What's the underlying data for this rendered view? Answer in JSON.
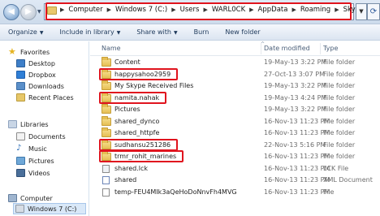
{
  "nav_buttons": {
    "back_glyph": "◀",
    "forward_glyph": "▶"
  },
  "address_bar": {
    "crumbs": [
      "Computer",
      "Windows 7 (C:)",
      "Users",
      "WARL0CK",
      "AppData",
      "Roaming",
      "Skype"
    ],
    "separator": "▶",
    "dropdown_glyph": "▼",
    "refresh_glyph": "⟳"
  },
  "toolbar": {
    "organize": "Organize",
    "include_in_library": "Include in library",
    "share_with": "Share with",
    "burn": "Burn",
    "new_folder": "New folder",
    "caret": "▼"
  },
  "nav_pane": {
    "favorites": "Favorites",
    "desktop": "Desktop",
    "dropbox": "Dropbox",
    "downloads": "Downloads",
    "recent_places": "Recent Places",
    "libraries": "Libraries",
    "documents": "Documents",
    "music": "Music",
    "pictures": "Pictures",
    "videos": "Videos",
    "computer": "Computer",
    "windows7": "Windows 7 (C:)"
  },
  "columns": {
    "name": "Name",
    "date_modified": "Date modified",
    "type": "Type",
    "sort_glyph": "^"
  },
  "files": [
    {
      "name": "Content",
      "date": "19-May-13 3:22 PM",
      "type": "File folder",
      "kind": "folder",
      "highlighted": false
    },
    {
      "name": "happysahoo2959",
      "date": "27-Oct-13 3:07 PM",
      "type": "File folder",
      "kind": "folder",
      "highlighted": true
    },
    {
      "name": "My Skype Received Files",
      "date": "19-May-13 3:22 PM",
      "type": "File folder",
      "kind": "folder",
      "highlighted": false
    },
    {
      "name": "namita.nahak",
      "date": "19-May-13 4:24 PM",
      "type": "File folder",
      "kind": "folder",
      "highlighted": true
    },
    {
      "name": "Pictures",
      "date": "19-May-13 3:22 PM",
      "type": "File folder",
      "kind": "folder",
      "highlighted": false
    },
    {
      "name": "shared_dynco",
      "date": "16-Nov-13 11:23 PM",
      "type": "File folder",
      "kind": "folder",
      "highlighted": false
    },
    {
      "name": "shared_httpfe",
      "date": "16-Nov-13 11:23 PM",
      "type": "File folder",
      "kind": "folder",
      "highlighted": false
    },
    {
      "name": "sudhansu251286",
      "date": "22-Nov-13 5:16 PM",
      "type": "File folder",
      "kind": "folder",
      "highlighted": true
    },
    {
      "name": "trmr_rohit_marines",
      "date": "16-Nov-13 11:23 PM",
      "type": "File folder",
      "kind": "folder",
      "highlighted": true
    },
    {
      "name": "shared.lck",
      "date": "16-Nov-13 11:23 PM",
      "type": "LCK File",
      "kind": "lck",
      "highlighted": false
    },
    {
      "name": "shared",
      "date": "16-Nov-13 11:23 PM",
      "type": "XML Document",
      "kind": "xml",
      "highlighted": false
    },
    {
      "name": "temp-FEU4MIk3aQeHoDoNnvFh4MVG",
      "date": "16-Nov-13 11:23 PM",
      "type": "File",
      "kind": "file",
      "highlighted": false
    }
  ]
}
